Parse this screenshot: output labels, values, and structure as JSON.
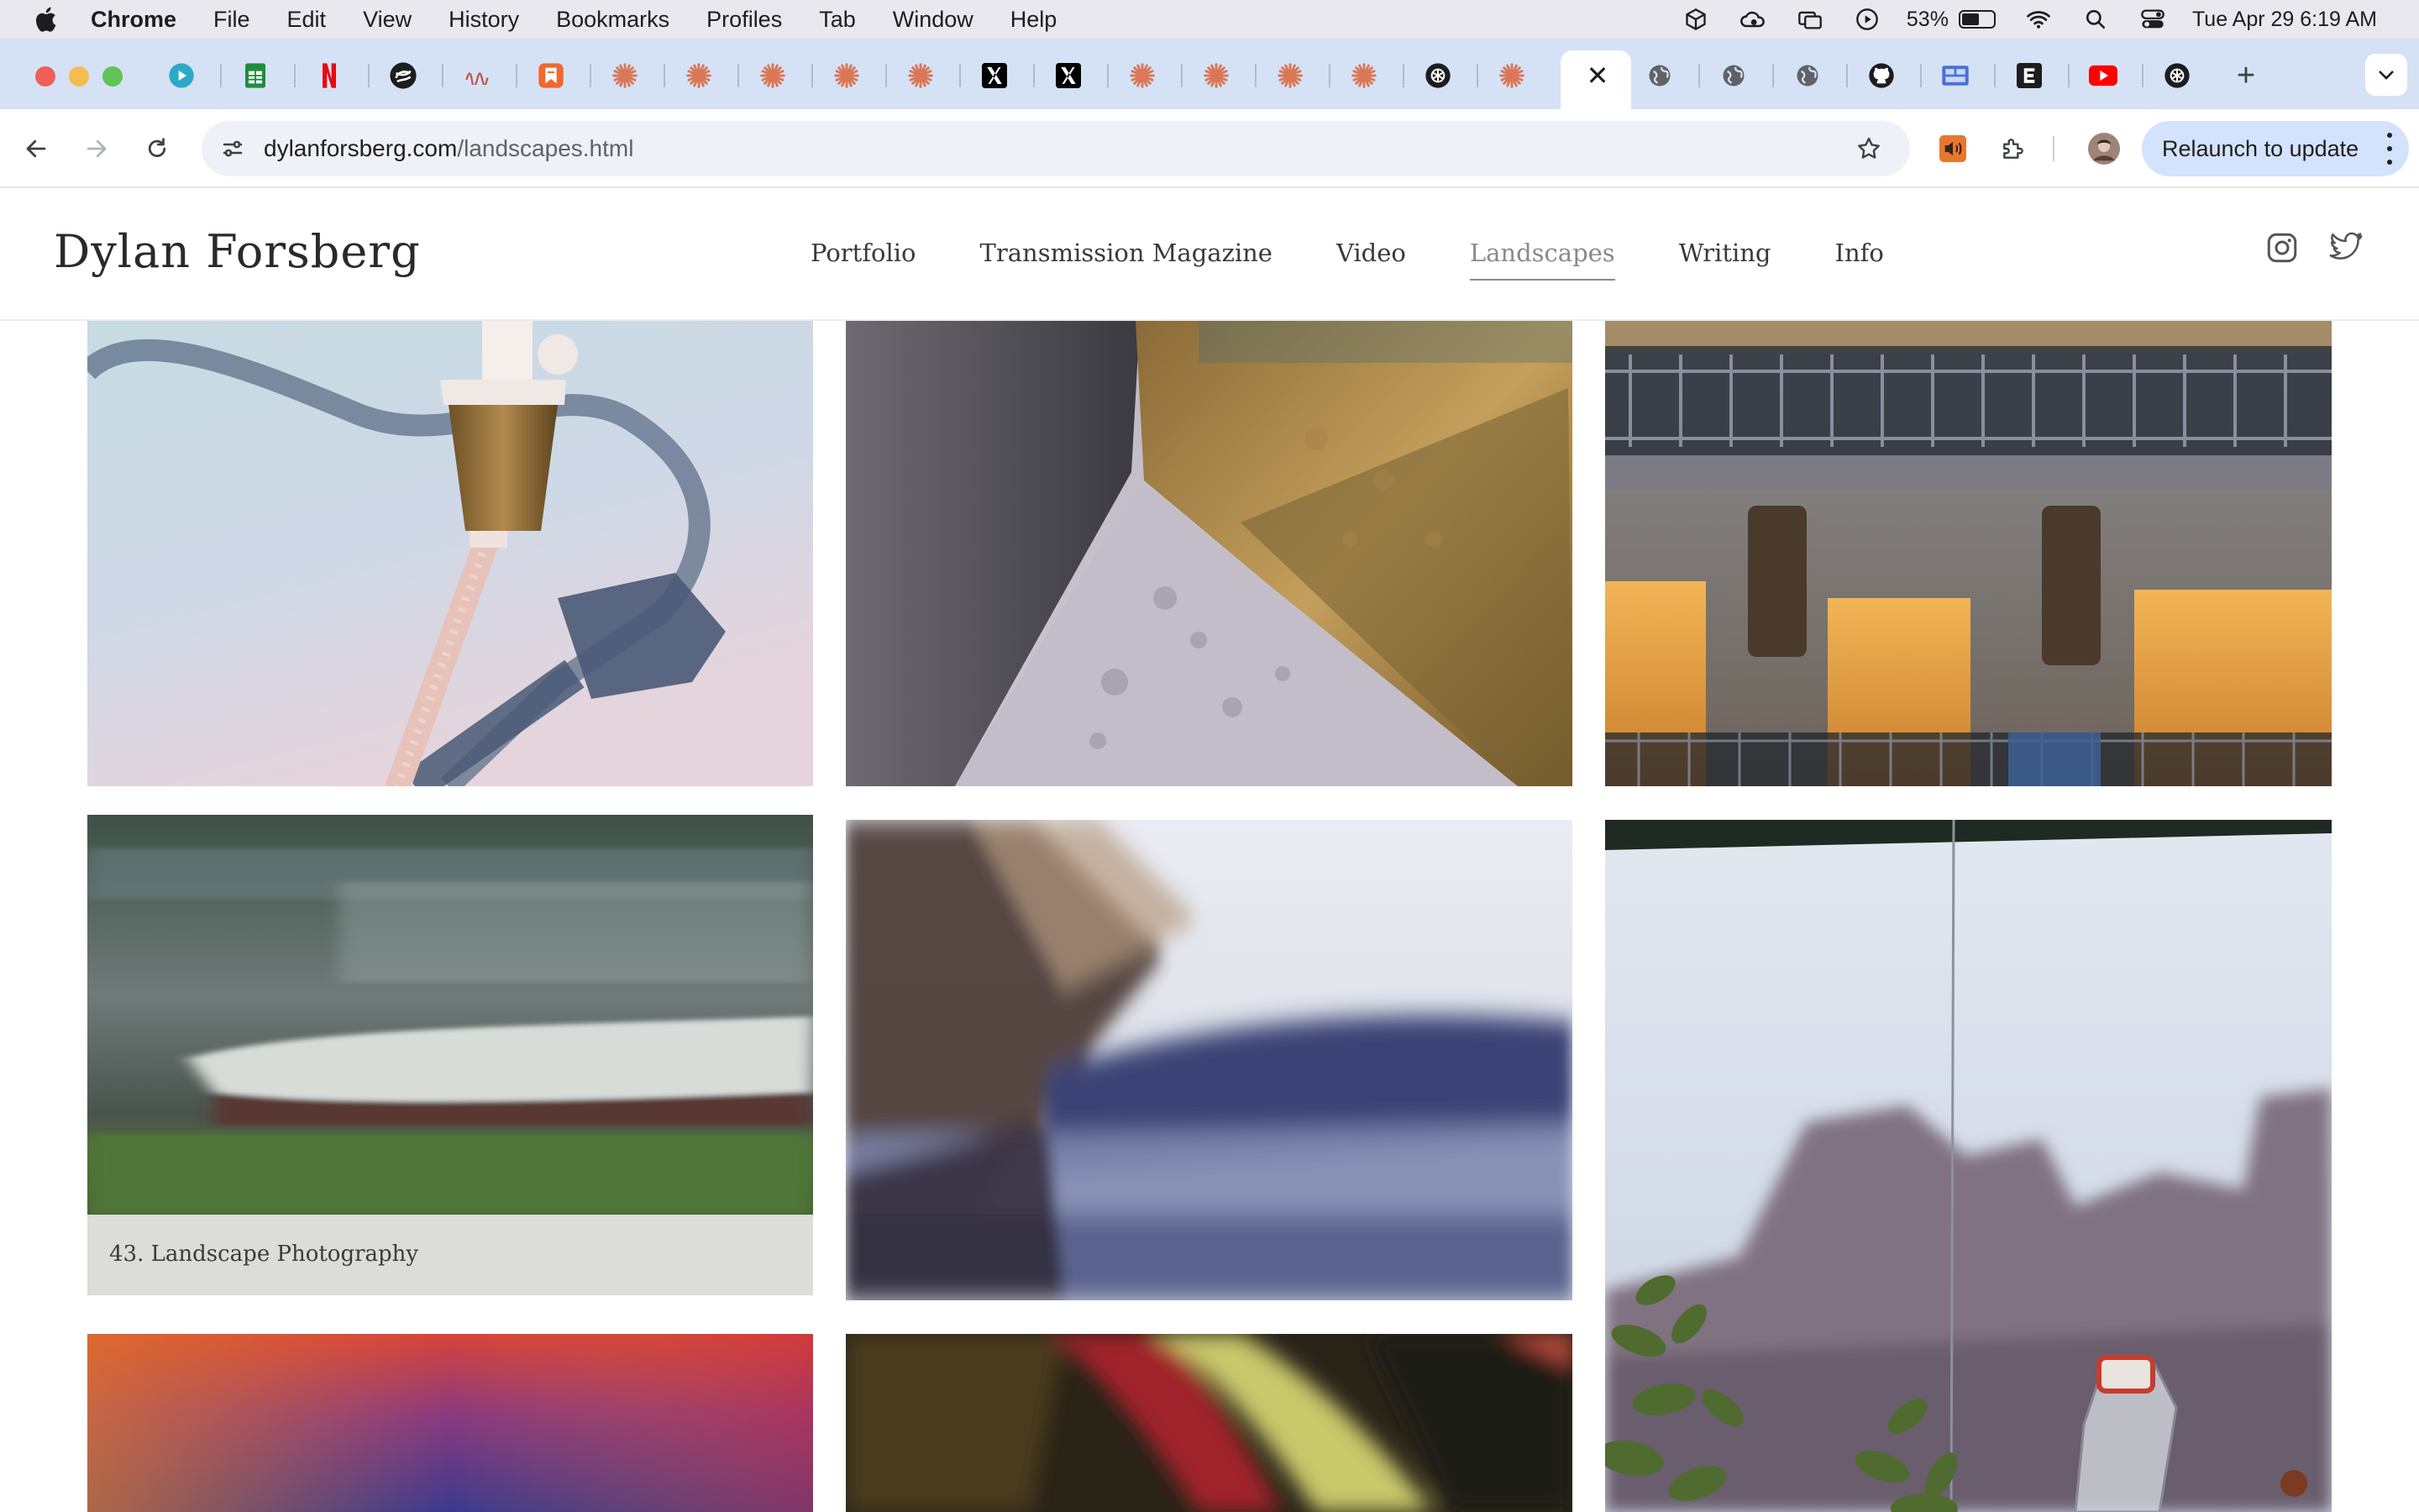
{
  "menubar": {
    "app_name": "Chrome",
    "menus": [
      "File",
      "Edit",
      "View",
      "History",
      "Bookmarks",
      "Profiles",
      "Tab",
      "Window",
      "Help"
    ],
    "battery_percent": "53%",
    "datetime": "Tue Apr 29  6:19 AM"
  },
  "tabs": {
    "favicons": [
      "video-player",
      "sheets",
      "netflix",
      "openai-like",
      "squiggle",
      "bookmark-orange",
      "claude",
      "claude",
      "claude",
      "claude",
      "claude",
      "x",
      "x",
      "claude",
      "claude",
      "claude",
      "claude",
      "chatgpt",
      "claude",
      "active-close",
      "globe",
      "globe",
      "globe",
      "github",
      "slides",
      "e-letter",
      "youtube",
      "chatgpt"
    ],
    "new_tab_label": "+"
  },
  "toolbar": {
    "url_domain": "dylanforsberg.com",
    "url_path": "/landscapes.html",
    "relaunch_label": "Relaunch to update"
  },
  "site": {
    "title": "Dylan Forsberg",
    "nav": [
      {
        "label": "Portfolio",
        "active": false
      },
      {
        "label": "Transmission Magazine",
        "active": false
      },
      {
        "label": "Video",
        "active": false
      },
      {
        "label": "Landscapes",
        "active": true
      },
      {
        "label": "Writing",
        "active": false
      },
      {
        "label": "Info",
        "active": false
      }
    ]
  },
  "gallery": {
    "caption": "43. Landscape Photography",
    "photos": [
      {
        "subject": "hose fitting on pale blue surface"
      },
      {
        "subject": "weathered brass corner with stone"
      },
      {
        "subject": "blurred apartment balconies"
      },
      {
        "subject": "motion-blurred boat on river"
      },
      {
        "subject": "motion-blurred trees and hills"
      },
      {
        "subject": "plants and bottle before blurred city"
      },
      {
        "subject": "red to purple gradient"
      },
      {
        "subject": "dark abstract with yellow streak"
      }
    ]
  },
  "colors": {
    "tabstrip_bg": "#d5e2f5",
    "relaunch_bg": "#d3e3fd",
    "nav_active": "#8a8a8a"
  }
}
